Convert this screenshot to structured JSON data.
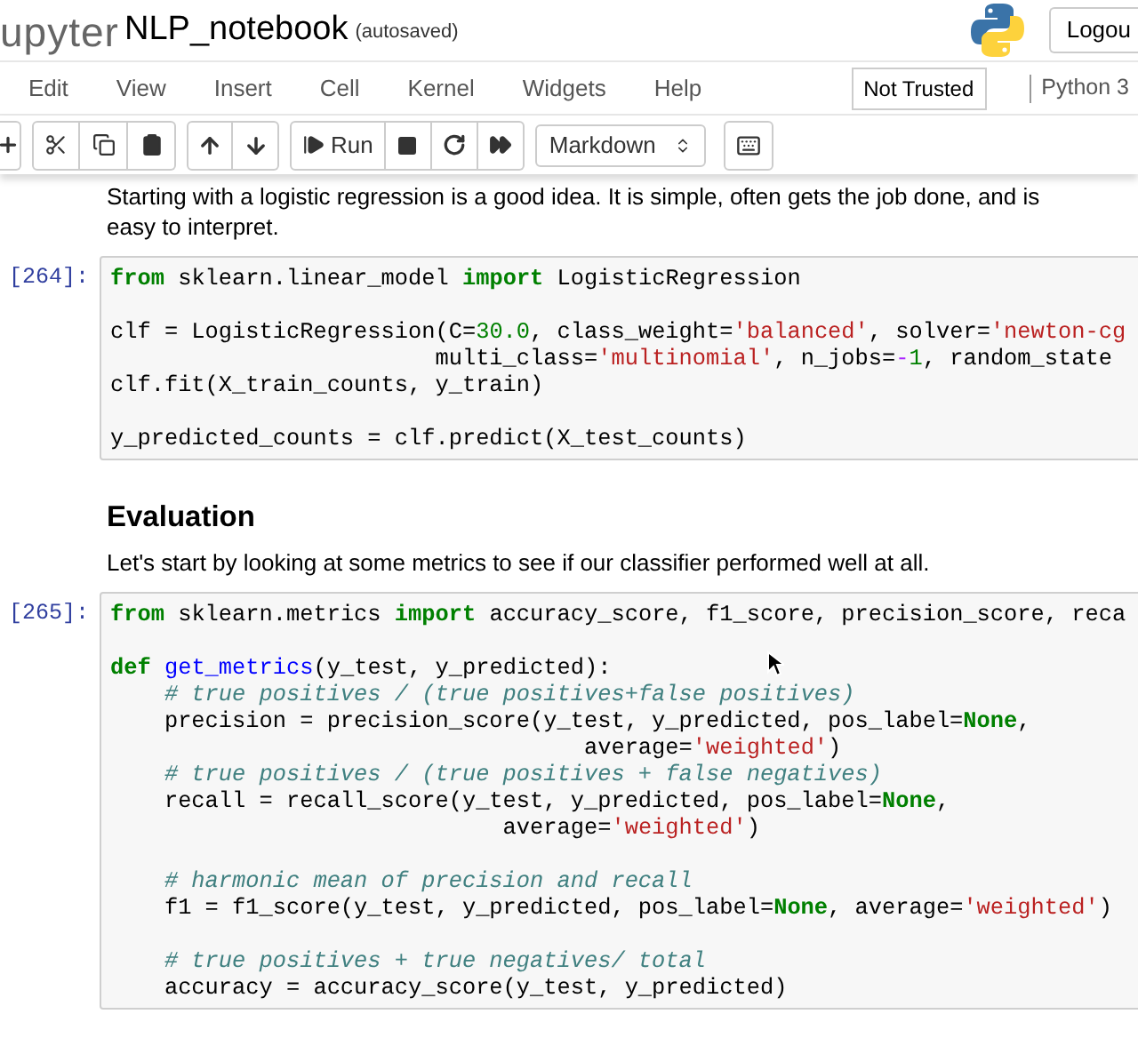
{
  "header": {
    "logo_text": "upyter",
    "notebook_name": "NLP_notebook",
    "save_status": "(autosaved)",
    "logout": "Logou"
  },
  "menu": [
    "Edit",
    "View",
    "Insert",
    "Cell",
    "Kernel",
    "Widgets",
    "Help"
  ],
  "trust_status": "Not Trusted",
  "kernel": "Python 3",
  "toolbar": {
    "run_label": "Run",
    "cell_type": "Markdown"
  },
  "notebook": [
    {
      "kind": "text",
      "text": "Starting with a logistic regression is a good idea. It is simple, often gets the job done, and is easy to interpret."
    },
    {
      "kind": "code",
      "prompt": "[264]:",
      "blocks": [
        [
          [
            {
              "kind": "kw",
              "text": "from"
            },
            {
              "kind": "plain",
              "text": " sklearn.linear_model "
            },
            {
              "kind": "kw",
              "text": "import"
            },
            {
              "kind": "plain",
              "text": " LogisticRegression"
            }
          ]
        ],
        [
          [
            {
              "kind": "plain",
              "text": "clf = LogisticRegression(C="
            },
            {
              "kind": "num",
              "text": "30.0"
            },
            {
              "kind": "plain",
              "text": ", class_weight="
            },
            {
              "kind": "str",
              "text": "'balanced'"
            },
            {
              "kind": "plain",
              "text": ", solver="
            },
            {
              "kind": "str",
              "text": "'newton-cg"
            }
          ],
          [
            {
              "kind": "plain",
              "text": "                        multi_class="
            },
            {
              "kind": "str",
              "text": "'multinomial'"
            },
            {
              "kind": "plain",
              "text": ", n_jobs="
            },
            {
              "kind": "op",
              "text": "-"
            },
            {
              "kind": "num",
              "text": "1"
            },
            {
              "kind": "plain",
              "text": ", random_state"
            }
          ],
          [
            {
              "kind": "plain",
              "text": "clf.fit(X_train_counts, y_train)"
            }
          ]
        ],
        [
          [
            {
              "kind": "plain",
              "text": "y_predicted_counts = clf.predict(X_test_counts)"
            }
          ]
        ]
      ]
    },
    {
      "kind": "heading",
      "text": "Evaluation"
    },
    {
      "kind": "text",
      "text": "Let's start by looking at some metrics to see if our classifier performed well at all."
    },
    {
      "kind": "code",
      "prompt": "[265]:",
      "blocks": [
        [
          [
            {
              "kind": "kw",
              "text": "from"
            },
            {
              "kind": "plain",
              "text": " sklearn.metrics "
            },
            {
              "kind": "kw",
              "text": "import"
            },
            {
              "kind": "plain",
              "text": " accuracy_score, f1_score, precision_score, reca"
            }
          ]
        ],
        [
          [
            {
              "kind": "kw",
              "text": "def "
            },
            {
              "kind": "fn",
              "text": "get_metrics"
            },
            {
              "kind": "plain",
              "text": "(y_test, y_predicted):"
            }
          ],
          [
            {
              "kind": "comment",
              "text": "    # true positives / (true positives+false positives)"
            }
          ],
          [
            {
              "kind": "plain",
              "text": "    precision = precision_score(y_test, y_predicted, pos_label="
            },
            {
              "kind": "kw",
              "text": "None"
            },
            {
              "kind": "plain",
              "text": ","
            }
          ],
          [
            {
              "kind": "plain",
              "text": "                                   average="
            },
            {
              "kind": "str",
              "text": "'weighted'"
            },
            {
              "kind": "plain",
              "text": ")"
            }
          ],
          [
            {
              "kind": "comment",
              "text": "    # true positives / (true positives + false negatives)"
            }
          ],
          [
            {
              "kind": "plain",
              "text": "    recall = recall_score(y_test, y_predicted, pos_label="
            },
            {
              "kind": "kw",
              "text": "None"
            },
            {
              "kind": "plain",
              "text": ","
            }
          ],
          [
            {
              "kind": "plain",
              "text": "                             average="
            },
            {
              "kind": "str",
              "text": "'weighted'"
            },
            {
              "kind": "plain",
              "text": ")"
            }
          ]
        ],
        [
          [
            {
              "kind": "comment",
              "text": "    # harmonic mean of precision and recall"
            }
          ],
          [
            {
              "kind": "plain",
              "text": "    f1 = f1_score(y_test, y_predicted, pos_label="
            },
            {
              "kind": "kw",
              "text": "None"
            },
            {
              "kind": "plain",
              "text": ", average="
            },
            {
              "kind": "str",
              "text": "'weighted'"
            },
            {
              "kind": "plain",
              "text": ")"
            }
          ]
        ],
        [
          [
            {
              "kind": "comment",
              "text": "    # true positives + true negatives/ total"
            }
          ],
          [
            {
              "kind": "plain",
              "text": "    accuracy = accuracy_score(y_test, y_predicted)"
            }
          ]
        ]
      ]
    }
  ]
}
